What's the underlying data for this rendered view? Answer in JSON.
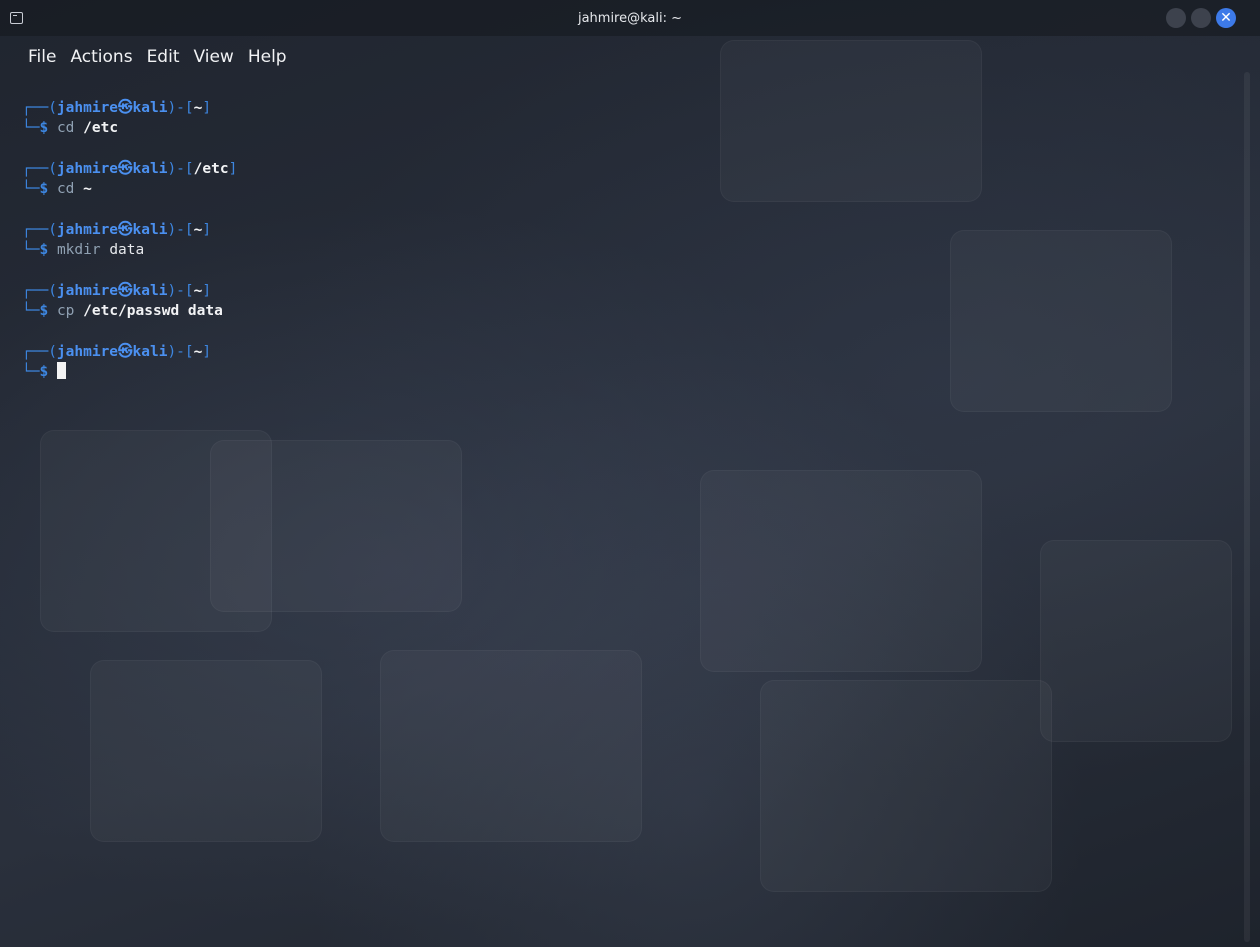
{
  "window": {
    "title": "jahmire@kali: ~",
    "close_glyph": "✕"
  },
  "menu": {
    "items": [
      "File",
      "Actions",
      "Edit",
      "View",
      "Help"
    ]
  },
  "prompt": {
    "user": "jahmire",
    "at_glyph": "㉿",
    "host": "kali",
    "frame_top": "┌──(",
    "frame_mid": ")-[",
    "frame_end": "]",
    "frame_bottom": "└─",
    "dollar": "$"
  },
  "terminal": {
    "blocks": [
      {
        "cwd": "~",
        "command": "cd",
        "argument": "/etc",
        "argument_bold": true
      },
      {
        "cwd": "/etc",
        "command": "cd",
        "argument": "~",
        "argument_bold": true
      },
      {
        "cwd": "~",
        "command": "mkdir",
        "argument": "data",
        "argument_bold": false
      },
      {
        "cwd": "~",
        "command": "cp",
        "argument": "/etc/passwd data",
        "argument_bold": true
      },
      {
        "cwd": "~",
        "command": "",
        "argument": "",
        "argument_bold": false
      }
    ]
  },
  "colors": {
    "accent": "#3d86e0",
    "user": "#4b90f0",
    "close_button": "#3d7ae8"
  },
  "icons": {
    "app": "terminal-icon",
    "close": "close-icon"
  }
}
